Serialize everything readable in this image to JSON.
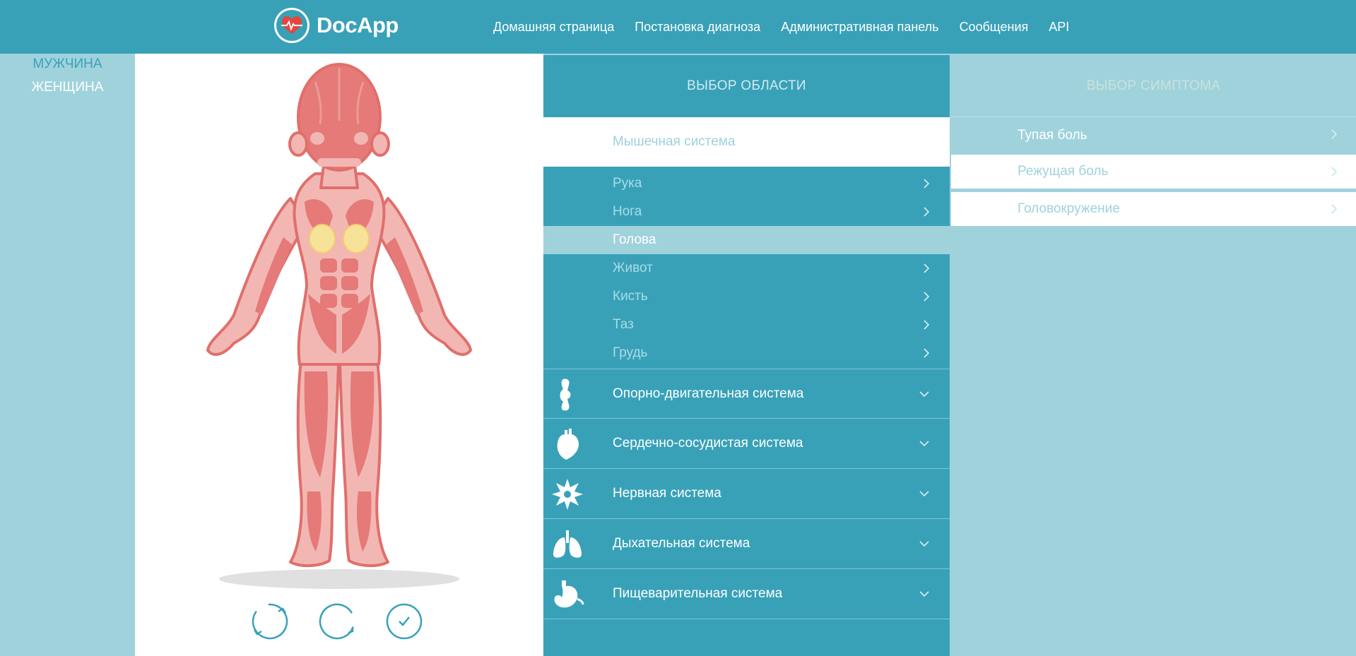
{
  "app": {
    "name": "DocApp"
  },
  "nav": {
    "items": [
      "Домашняя страница",
      "Постановка диагноза",
      "Административная панель",
      "Сообщения",
      "API"
    ]
  },
  "gender": {
    "male": "МУЖЧИНА",
    "female": "ЖЕНЩИНА",
    "selected": "female"
  },
  "region_panel": {
    "title": "ВЫБОР ОБЛАСТИ",
    "open_system": "Мышечная система",
    "subitems": [
      {
        "label": "Рука",
        "chevron": true,
        "active": false
      },
      {
        "label": "Нога",
        "chevron": true,
        "active": false
      },
      {
        "label": "Голова",
        "chevron": false,
        "active": true
      },
      {
        "label": "Живот",
        "chevron": true,
        "active": false
      },
      {
        "label": "Кисть",
        "chevron": true,
        "active": false
      },
      {
        "label": "Таз",
        "chevron": true,
        "active": false
      },
      {
        "label": "Грудь",
        "chevron": true,
        "active": false
      }
    ],
    "systems": [
      {
        "label": "Опорно-двигательная система",
        "icon": "joint-icon"
      },
      {
        "label": "Сердечно-сосудистая система",
        "icon": "heart-icon"
      },
      {
        "label": "Нервная система",
        "icon": "neuron-icon"
      },
      {
        "label": "Дыхательная система",
        "icon": "lungs-icon"
      },
      {
        "label": "Пищеварительная система",
        "icon": "stomach-icon"
      }
    ]
  },
  "symptom_panel": {
    "title": "ВЫБОР СИМПТОМА",
    "items": [
      "Тупая боль",
      "Режущая боль",
      "Головокружение"
    ]
  },
  "figure": {
    "controls": [
      "rotate-left-icon",
      "rotate-right-icon",
      "confirm-icon"
    ]
  },
  "colors": {
    "primary": "#38a1b8",
    "light": "#a0d2dc",
    "muscle": "#e57a78",
    "muscle_light": "#f2b7b3",
    "highlight": "#f7e29a"
  }
}
